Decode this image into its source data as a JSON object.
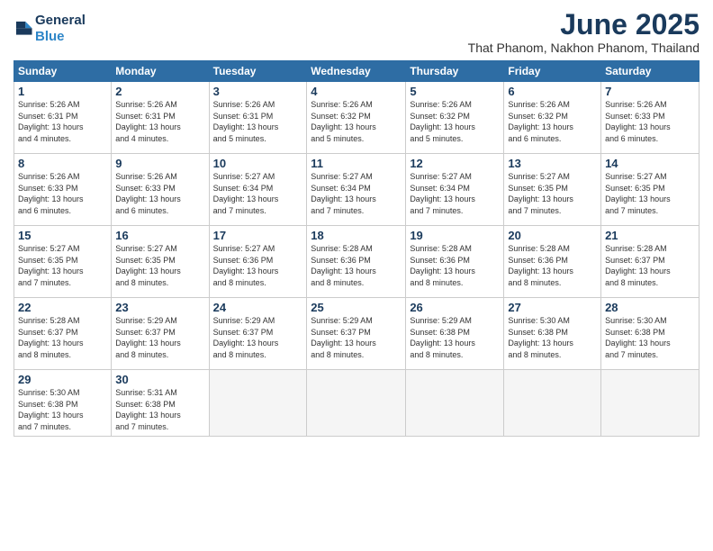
{
  "logo": {
    "line1": "General",
    "line2": "Blue"
  },
  "title": "June 2025",
  "location": "That Phanom, Nakhon Phanom, Thailand",
  "days_of_week": [
    "Sunday",
    "Monday",
    "Tuesday",
    "Wednesday",
    "Thursday",
    "Friday",
    "Saturday"
  ],
  "weeks": [
    [
      {
        "day": "1",
        "info": "Sunrise: 5:26 AM\nSunset: 6:31 PM\nDaylight: 13 hours\nand 4 minutes."
      },
      {
        "day": "2",
        "info": "Sunrise: 5:26 AM\nSunset: 6:31 PM\nDaylight: 13 hours\nand 4 minutes."
      },
      {
        "day": "3",
        "info": "Sunrise: 5:26 AM\nSunset: 6:31 PM\nDaylight: 13 hours\nand 5 minutes."
      },
      {
        "day": "4",
        "info": "Sunrise: 5:26 AM\nSunset: 6:32 PM\nDaylight: 13 hours\nand 5 minutes."
      },
      {
        "day": "5",
        "info": "Sunrise: 5:26 AM\nSunset: 6:32 PM\nDaylight: 13 hours\nand 5 minutes."
      },
      {
        "day": "6",
        "info": "Sunrise: 5:26 AM\nSunset: 6:32 PM\nDaylight: 13 hours\nand 6 minutes."
      },
      {
        "day": "7",
        "info": "Sunrise: 5:26 AM\nSunset: 6:33 PM\nDaylight: 13 hours\nand 6 minutes."
      }
    ],
    [
      {
        "day": "8",
        "info": "Sunrise: 5:26 AM\nSunset: 6:33 PM\nDaylight: 13 hours\nand 6 minutes."
      },
      {
        "day": "9",
        "info": "Sunrise: 5:26 AM\nSunset: 6:33 PM\nDaylight: 13 hours\nand 6 minutes."
      },
      {
        "day": "10",
        "info": "Sunrise: 5:27 AM\nSunset: 6:34 PM\nDaylight: 13 hours\nand 7 minutes."
      },
      {
        "day": "11",
        "info": "Sunrise: 5:27 AM\nSunset: 6:34 PM\nDaylight: 13 hours\nand 7 minutes."
      },
      {
        "day": "12",
        "info": "Sunrise: 5:27 AM\nSunset: 6:34 PM\nDaylight: 13 hours\nand 7 minutes."
      },
      {
        "day": "13",
        "info": "Sunrise: 5:27 AM\nSunset: 6:35 PM\nDaylight: 13 hours\nand 7 minutes."
      },
      {
        "day": "14",
        "info": "Sunrise: 5:27 AM\nSunset: 6:35 PM\nDaylight: 13 hours\nand 7 minutes."
      }
    ],
    [
      {
        "day": "15",
        "info": "Sunrise: 5:27 AM\nSunset: 6:35 PM\nDaylight: 13 hours\nand 7 minutes."
      },
      {
        "day": "16",
        "info": "Sunrise: 5:27 AM\nSunset: 6:35 PM\nDaylight: 13 hours\nand 8 minutes."
      },
      {
        "day": "17",
        "info": "Sunrise: 5:27 AM\nSunset: 6:36 PM\nDaylight: 13 hours\nand 8 minutes."
      },
      {
        "day": "18",
        "info": "Sunrise: 5:28 AM\nSunset: 6:36 PM\nDaylight: 13 hours\nand 8 minutes."
      },
      {
        "day": "19",
        "info": "Sunrise: 5:28 AM\nSunset: 6:36 PM\nDaylight: 13 hours\nand 8 minutes."
      },
      {
        "day": "20",
        "info": "Sunrise: 5:28 AM\nSunset: 6:36 PM\nDaylight: 13 hours\nand 8 minutes."
      },
      {
        "day": "21",
        "info": "Sunrise: 5:28 AM\nSunset: 6:37 PM\nDaylight: 13 hours\nand 8 minutes."
      }
    ],
    [
      {
        "day": "22",
        "info": "Sunrise: 5:28 AM\nSunset: 6:37 PM\nDaylight: 13 hours\nand 8 minutes."
      },
      {
        "day": "23",
        "info": "Sunrise: 5:29 AM\nSunset: 6:37 PM\nDaylight: 13 hours\nand 8 minutes."
      },
      {
        "day": "24",
        "info": "Sunrise: 5:29 AM\nSunset: 6:37 PM\nDaylight: 13 hours\nand 8 minutes."
      },
      {
        "day": "25",
        "info": "Sunrise: 5:29 AM\nSunset: 6:37 PM\nDaylight: 13 hours\nand 8 minutes."
      },
      {
        "day": "26",
        "info": "Sunrise: 5:29 AM\nSunset: 6:38 PM\nDaylight: 13 hours\nand 8 minutes."
      },
      {
        "day": "27",
        "info": "Sunrise: 5:30 AM\nSunset: 6:38 PM\nDaylight: 13 hours\nand 8 minutes."
      },
      {
        "day": "28",
        "info": "Sunrise: 5:30 AM\nSunset: 6:38 PM\nDaylight: 13 hours\nand 7 minutes."
      }
    ],
    [
      {
        "day": "29",
        "info": "Sunrise: 5:30 AM\nSunset: 6:38 PM\nDaylight: 13 hours\nand 7 minutes."
      },
      {
        "day": "30",
        "info": "Sunrise: 5:31 AM\nSunset: 6:38 PM\nDaylight: 13 hours\nand 7 minutes."
      },
      {
        "day": "",
        "info": ""
      },
      {
        "day": "",
        "info": ""
      },
      {
        "day": "",
        "info": ""
      },
      {
        "day": "",
        "info": ""
      },
      {
        "day": "",
        "info": ""
      }
    ]
  ]
}
